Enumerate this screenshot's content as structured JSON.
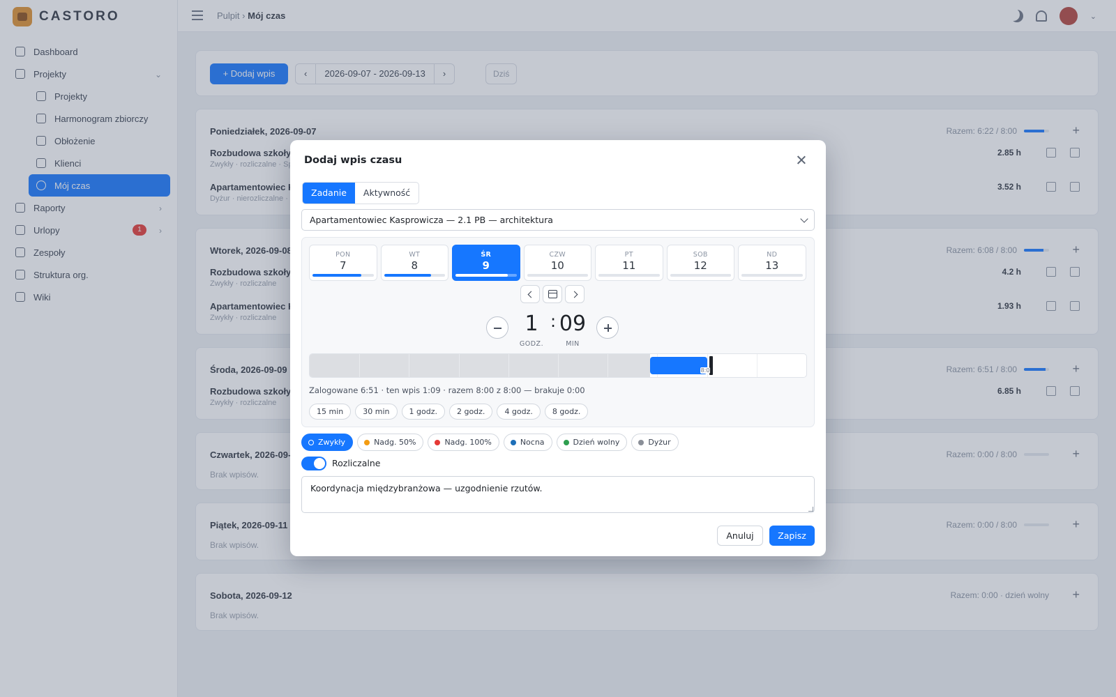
{
  "app": {
    "brand": "CASTORO"
  },
  "sidebar": {
    "items": [
      {
        "label": "Dashboard"
      },
      {
        "label": "Projekty"
      },
      {
        "label": "Projekty"
      },
      {
        "label": "Harmonogram zbiorczy"
      },
      {
        "label": "Obłożenie"
      },
      {
        "label": "Klienci"
      },
      {
        "label": "Mój czas"
      },
      {
        "label": "Raporty"
      },
      {
        "label": "Urlopy",
        "badge": "1"
      },
      {
        "label": "Zespoły"
      },
      {
        "label": "Struktura org."
      },
      {
        "label": "Wiki"
      }
    ]
  },
  "topbar": {
    "crumb_root": "Pulpit",
    "crumb_sep": "›",
    "crumb_current": "Mój czas"
  },
  "toolbar": {
    "add_label": "+ Dodaj wpis",
    "range": "2026-09-07 - 2026-09-13",
    "today": "Dziś"
  },
  "days": [
    {
      "title": "Poniedziałek, 2026-09-07",
      "total": "Razem: 6:22 / 8:00",
      "fill": 0.8,
      "entries": [
        {
          "title": "Rozbudowa szkoły p",
          "sub": "Zwykły · rozliczalne · Sp",
          "hours": "2.85 h"
        },
        {
          "title": "Apartamentowiec Ka",
          "sub": "Dyżur · nierozliczalne · Pr",
          "hours": "3.52 h"
        }
      ]
    },
    {
      "title": "Wtorek, 2026-09-08",
      "total": "Razem: 6:08 / 8:00",
      "fill": 0.77,
      "entries": [
        {
          "title": "Rozbudowa szkoły p",
          "sub": "Zwykły · rozliczalne",
          "hours": "4.2 h"
        },
        {
          "title": "Apartamentowiec Ka",
          "sub": "Zwykły · rozliczalne",
          "hours": "1.93 h"
        }
      ]
    },
    {
      "title": "Środa, 2026-09-09",
      "total": "Razem: 6:51 / 8:00",
      "fill": 0.86,
      "entries": [
        {
          "title": "Rozbudowa szkoły p",
          "sub": "Zwykły · rozliczalne",
          "hours": "6.85 h"
        }
      ]
    },
    {
      "title": "Czwartek, 2026-09-1",
      "total": "Razem: 0:00 / 8:00",
      "fill": 0,
      "empty": "Brak wpisów."
    },
    {
      "title": "Piątek, 2026-09-11",
      "total": "Razem: 0:00 / 8:00",
      "fill": 0,
      "empty": "Brak wpisów."
    },
    {
      "title": "Sobota, 2026-09-12",
      "total": "Razem: 0:00 · dzień wolny",
      "fill": null,
      "empty": "Brak wpisów."
    }
  ],
  "modal": {
    "title": "Dodaj wpis czasu",
    "tabs": [
      {
        "label": "Zadanie",
        "active": true
      },
      {
        "label": "Aktywność",
        "active": false
      }
    ],
    "task_select": "Apartamentowiec Kasprowicza — 2.1 PB — architektura",
    "week": [
      {
        "name": "PON",
        "num": "7",
        "fill": 0.8,
        "selected": false
      },
      {
        "name": "WT",
        "num": "8",
        "fill": 0.77,
        "selected": false
      },
      {
        "name": "ŚR",
        "num": "9",
        "fill": 0.86,
        "selected": true
      },
      {
        "name": "CZW",
        "num": "10",
        "fill": 0,
        "selected": false
      },
      {
        "name": "PT",
        "num": "11",
        "fill": 0,
        "selected": false
      },
      {
        "name": "SOB",
        "num": "12",
        "fill": 0,
        "selected": false
      },
      {
        "name": "ND",
        "num": "13",
        "fill": 0,
        "selected": false
      }
    ],
    "time": {
      "hours": "1",
      "separator": ":",
      "minutes": "09",
      "hours_label": "GODZ.",
      "minutes_label": "MIN"
    },
    "timeline": {
      "logged_minutes": 411,
      "entry_minutes": 69,
      "target_minutes": 480,
      "scale_minutes": 600,
      "target_label": "8:0"
    },
    "summary": "Zalogowane 6:51 · ten wpis 1:09 · razem 8:00 z 8:00 — brakuje 0:00",
    "quick": [
      "15 min",
      "30 min",
      "1 godz.",
      "2 godz.",
      "4 godz.",
      "8 godz."
    ],
    "types": [
      {
        "label": "Zwykły",
        "color": "#1677ff",
        "active": true
      },
      {
        "label": "Nadg. 50%",
        "color": "#f39c12",
        "active": false
      },
      {
        "label": "Nadg. 100%",
        "color": "#e53935",
        "active": false
      },
      {
        "label": "Nocna",
        "color": "#1e6fb8",
        "active": false
      },
      {
        "label": "Dzień wolny",
        "color": "#2e9e4f",
        "active": false
      },
      {
        "label": "Dyżur",
        "color": "#8a8f98",
        "active": false
      }
    ],
    "billable_label": "Rozliczalne",
    "billable": true,
    "note": "Koordynacja międzybranżowa — uzgodnienie rzutów.",
    "cancel_label": "Anuluj",
    "save_label": "Zapisz"
  }
}
